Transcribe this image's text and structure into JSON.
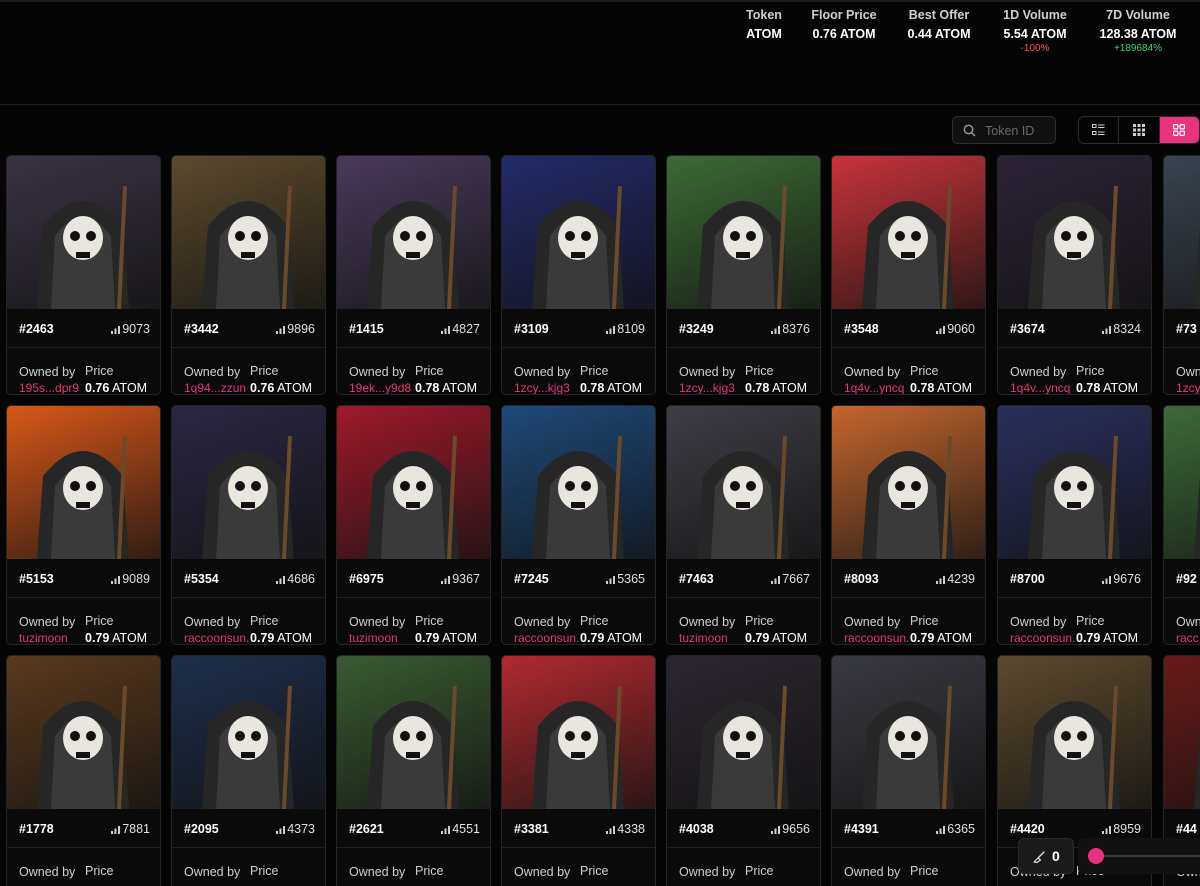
{
  "stats": [
    {
      "label": "Token",
      "value": "ATOM",
      "change": "",
      "trend": ""
    },
    {
      "label": "Floor Price",
      "value": "0.76 ATOM",
      "change": "",
      "trend": ""
    },
    {
      "label": "Best Offer",
      "value": "0.44 ATOM",
      "change": "",
      "trend": ""
    },
    {
      "label": "1D Volume",
      "value": "5.54 ATOM",
      "change": "-100%",
      "trend": "neg"
    },
    {
      "label": "7D Volume",
      "value": "128.38 ATOM",
      "change": "+189684%",
      "trend": "pos"
    }
  ],
  "search": {
    "placeholder": "Token ID"
  },
  "view_modes": [
    "list-view",
    "compact-grid-view",
    "large-grid-view"
  ],
  "active_view": "large-grid-view",
  "labels": {
    "owned_by": "Owned by",
    "price": "Price"
  },
  "colors": {
    "accent": "#e8337f",
    "positive": "#3fd17a",
    "negative": "#ff4d4d"
  },
  "cards": [
    {
      "id": "#2463",
      "rank": "9073",
      "owner": "195s...dpr9",
      "price": "0.76",
      "currency": "ATOM",
      "bg": "#3a3344"
    },
    {
      "id": "#3442",
      "rank": "9896",
      "owner": "1q94...zzun",
      "price": "0.76",
      "currency": "ATOM",
      "bg": "#5c4a2e"
    },
    {
      "id": "#1415",
      "rank": "4827",
      "owner": "19ek...y9d8",
      "price": "0.78",
      "currency": "ATOM",
      "bg": "#4a3a5a"
    },
    {
      "id": "#3109",
      "rank": "8109",
      "owner": "1zcy...kjg3",
      "price": "0.78",
      "currency": "ATOM",
      "bg": "#232a6a"
    },
    {
      "id": "#3249",
      "rank": "8376",
      "owner": "1zcy...kjg3",
      "price": "0.78",
      "currency": "ATOM",
      "bg": "#3d6a36"
    },
    {
      "id": "#3548",
      "rank": "9060",
      "owner": "1q4v...yncq",
      "price": "0.78",
      "currency": "ATOM",
      "bg": "#c8343a"
    },
    {
      "id": "#3674",
      "rank": "8324",
      "owner": "1q4v...yncq",
      "price": "0.78",
      "currency": "ATOM",
      "bg": "#2c2336"
    },
    {
      "id": "#73",
      "rank": "",
      "owner": "1zcy",
      "price": "",
      "currency": "",
      "bg": "#3a4450"
    },
    {
      "id": "#5153",
      "rank": "9089",
      "owner": "tuzimoon",
      "price": "0.79",
      "currency": "ATOM",
      "bg": "#d8571a"
    },
    {
      "id": "#5354",
      "rank": "4686",
      "owner": "raccoonsun.",
      "price": "0.79",
      "currency": "ATOM",
      "bg": "#2a2742"
    },
    {
      "id": "#6975",
      "rank": "9367",
      "owner": "tuzimoon",
      "price": "0.79",
      "currency": "ATOM",
      "bg": "#9e1a2c"
    },
    {
      "id": "#7245",
      "rank": "5365",
      "owner": "raccoonsun.",
      "price": "0.79",
      "currency": "ATOM",
      "bg": "#1e4a7a"
    },
    {
      "id": "#7463",
      "rank": "7667",
      "owner": "tuzimoon",
      "price": "0.79",
      "currency": "ATOM",
      "bg": "#3e3e46"
    },
    {
      "id": "#8093",
      "rank": "4239",
      "owner": "raccoonsun.",
      "price": "0.79",
      "currency": "ATOM",
      "bg": "#c4662e"
    },
    {
      "id": "#8700",
      "rank": "9676",
      "owner": "raccoonsun.",
      "price": "0.79",
      "currency": "ATOM",
      "bg": "#2a2f5e"
    },
    {
      "id": "#92",
      "rank": "",
      "owner": "racc",
      "price": "",
      "currency": "",
      "bg": "#3e6a3a"
    },
    {
      "id": "#1778",
      "rank": "7881",
      "owner": "",
      "price": "",
      "currency": "",
      "bg": "#5a3a1e"
    },
    {
      "id": "#2095",
      "rank": "4373",
      "owner": "",
      "price": "",
      "currency": "",
      "bg": "#1e2e4a"
    },
    {
      "id": "#2621",
      "rank": "4551",
      "owner": "",
      "price": "",
      "currency": "",
      "bg": "#3a5a32"
    },
    {
      "id": "#3381",
      "rank": "4338",
      "owner": "",
      "price": "",
      "currency": "",
      "bg": "#b02a30"
    },
    {
      "id": "#4038",
      "rank": "9656",
      "owner": "",
      "price": "",
      "currency": "",
      "bg": "#2c2630"
    },
    {
      "id": "#4391",
      "rank": "6365",
      "owner": "",
      "price": "",
      "currency": "",
      "bg": "#3a3a42"
    },
    {
      "id": "#4420",
      "rank": "8959",
      "owner": "",
      "price": "",
      "currency": "",
      "bg": "#5c4a2e"
    },
    {
      "id": "#44",
      "rank": "",
      "owner": "",
      "price": "",
      "currency": "",
      "bg": "#6a1a1a"
    }
  ],
  "cart": {
    "count": "0"
  },
  "sweep": {
    "value": 0
  }
}
